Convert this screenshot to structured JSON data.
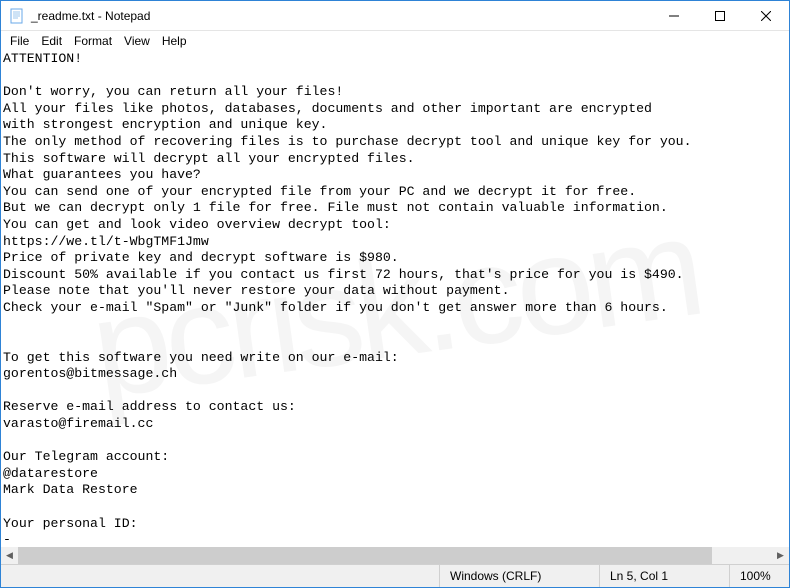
{
  "window": {
    "title": "_readme.txt - Notepad"
  },
  "menu": {
    "file": "File",
    "edit": "Edit",
    "format": "Format",
    "view": "View",
    "help": "Help"
  },
  "document": {
    "text": "ATTENTION!\n\nDon't worry, you can return all your files!\nAll your files like photos, databases, documents and other important are encrypted\nwith strongest encryption and unique key.\nThe only method of recovering files is to purchase decrypt tool and unique key for you.\nThis software will decrypt all your encrypted files.\nWhat guarantees you have?\nYou can send one of your encrypted file from your PC and we decrypt it for free.\nBut we can decrypt only 1 file for free. File must not contain valuable information.\nYou can get and look video overview decrypt tool:\nhttps://we.tl/t-WbgTMF1Jmw\nPrice of private key and decrypt software is $980.\nDiscount 50% available if you contact us first 72 hours, that's price for you is $490.\nPlease note that you'll never restore your data without payment.\nCheck your e-mail \"Spam\" or \"Junk\" folder if you don't get answer more than 6 hours.\n\n\nTo get this software you need write on our e-mail:\ngorentos@bitmessage.ch\n\nReserve e-mail address to contact us:\nvarasto@firemail.cc\n\nOur Telegram account:\n@datarestore\nMark Data Restore\n\nYour personal ID:\n-"
  },
  "statusbar": {
    "encoding": "Windows (CRLF)",
    "position": "Ln 5, Col 1",
    "zoom": "100%"
  },
  "watermark": "pcrisk.com"
}
